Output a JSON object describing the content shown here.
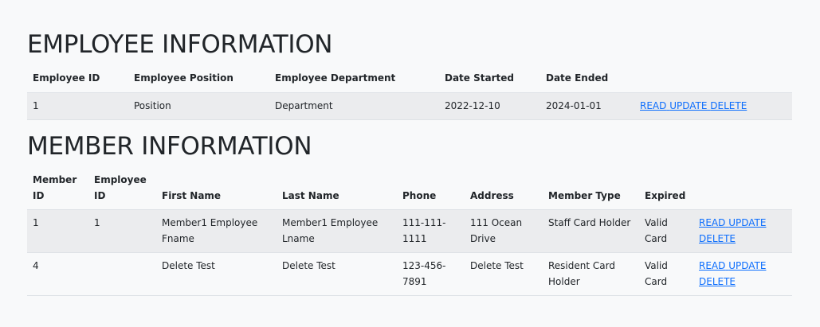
{
  "employee": {
    "title": "EMPLOYEE INFORMATION",
    "headers": [
      "Employee ID",
      "Employee Position",
      "Employee Department",
      "Date Started",
      "Date Ended"
    ],
    "rows": [
      {
        "id": "1",
        "position": "Position",
        "department": "Department",
        "started": "2022-12-10",
        "ended": "2024-01-01"
      }
    ]
  },
  "member": {
    "title": "MEMBER INFORMATION",
    "headers": [
      "Member ID",
      "Employee ID",
      "First Name",
      "Last Name",
      "Phone",
      "Address",
      "Member Type",
      "Expired"
    ],
    "rows": [
      {
        "member_id": "1",
        "employee_id": "1",
        "first": "Member1 Employee Fname",
        "last": "Member1 Employee Lname",
        "phone": "111-111-1111",
        "address": "111 Ocean Drive",
        "type": "Staff Card Holder",
        "expired": "Valid Card"
      },
      {
        "member_id": "4",
        "employee_id": "",
        "first": "Delete Test",
        "last": "Delete Test",
        "phone": "123-456-7891",
        "address": "Delete Test",
        "type": "Resident Card Holder",
        "expired": "Valid Card"
      }
    ]
  },
  "actions": {
    "read": "READ",
    "update": "UPDATE",
    "delete": "DELETE"
  }
}
